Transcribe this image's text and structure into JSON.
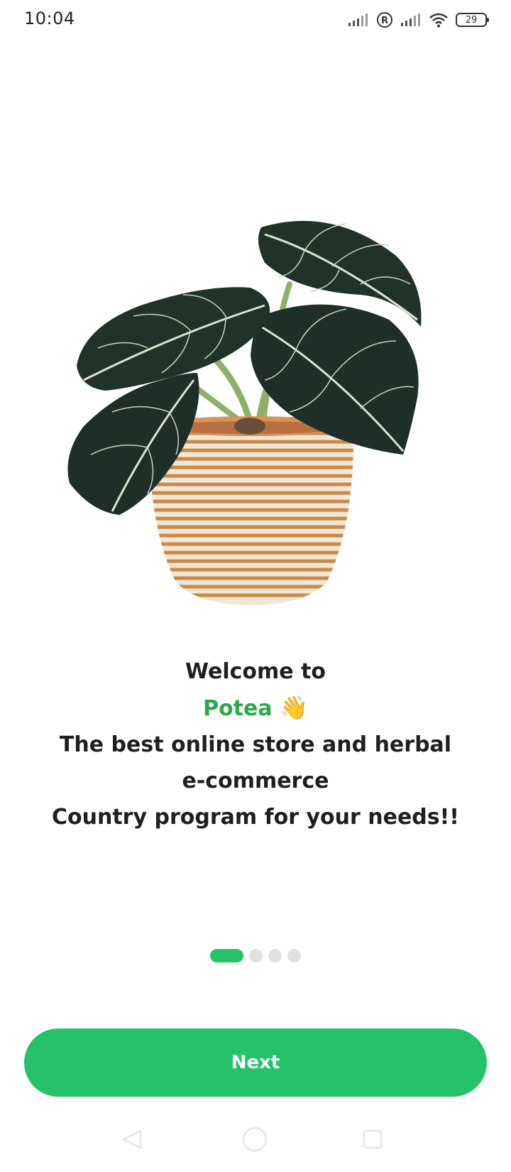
{
  "status_bar": {
    "time": "10:04",
    "battery_level": "29",
    "icons": [
      "signal-icon",
      "registered-icon",
      "signal-icon",
      "wifi-icon",
      "battery-icon"
    ]
  },
  "illustration": {
    "icon": "potted-plant-image"
  },
  "welcome": {
    "line1": "Welcome to",
    "brand": "Potea",
    "wave_emoji": "👋",
    "line3": "The best online store and herbal",
    "line4": "e-commerce",
    "line5": "Country program for your needs!!"
  },
  "pager": {
    "total": 4,
    "current": 1
  },
  "actions": {
    "next_label": "Next"
  },
  "nav_bar": {
    "icons": [
      "back-icon",
      "home-icon",
      "recents-icon"
    ]
  },
  "colors": {
    "accent": "#25c26a",
    "brand_text": "#2aa84a",
    "text": "#1f1f1f",
    "dot_inactive": "#e0e0e0"
  }
}
